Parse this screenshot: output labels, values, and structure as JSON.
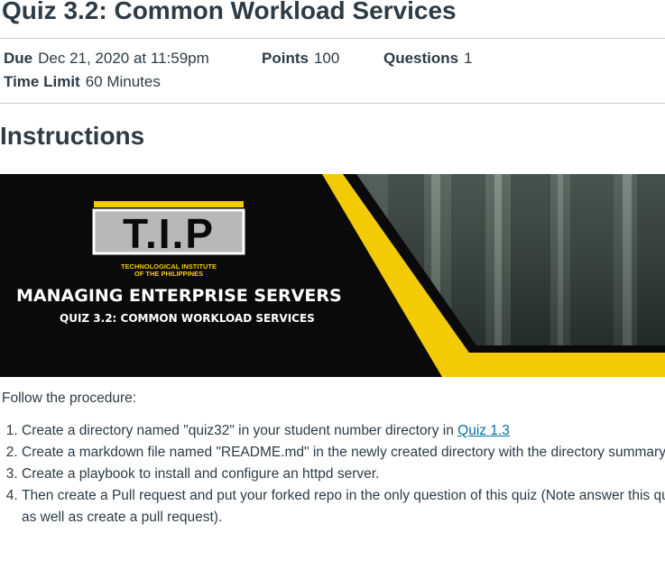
{
  "quiz": {
    "title": "Quiz 3.2: Common Workload Services",
    "due_label": "Due",
    "due_value": "Dec 21, 2020 at 11:59pm",
    "points_label": "Points",
    "points_value": "100",
    "questions_label": "Questions",
    "questions_value": "1",
    "time_limit_label": "Time Limit",
    "time_limit_value": "60 Minutes"
  },
  "instructions": {
    "heading": "Instructions",
    "banner": {
      "logo_text": "T.I.P",
      "institute_line1": "TECHNOLOGICAL INSTITUTE",
      "institute_line2": "OF THE PHILIPPINES",
      "course_title": "MANAGING ENTERPRISE SERVERS",
      "quiz_subtitle": "QUIZ 3.2: COMMON WORKLOAD SERVICES",
      "colors": {
        "black": "#0a0a0a",
        "yellow": "#f2cb05",
        "gray": "#b8b8b8"
      }
    },
    "intro": "Follow the procedure:",
    "steps": [
      {
        "text": "Create a directory named \"quiz32\" in your student number directory in ",
        "link": "Quiz 1.3"
      },
      {
        "text": "Create a markdown file named \"README.md\" in the newly created directory with the directory summary."
      },
      {
        "text": "Create a playbook to install and configure an httpd server."
      },
      {
        "text": "Then create a Pull request and put your forked repo in the only question of this quiz (Note answer this quiz as well as create a pull request)."
      }
    ]
  },
  "theme": {
    "text": "#2d3b45",
    "link": "#0770a3",
    "rule": "#c7cdd1"
  }
}
